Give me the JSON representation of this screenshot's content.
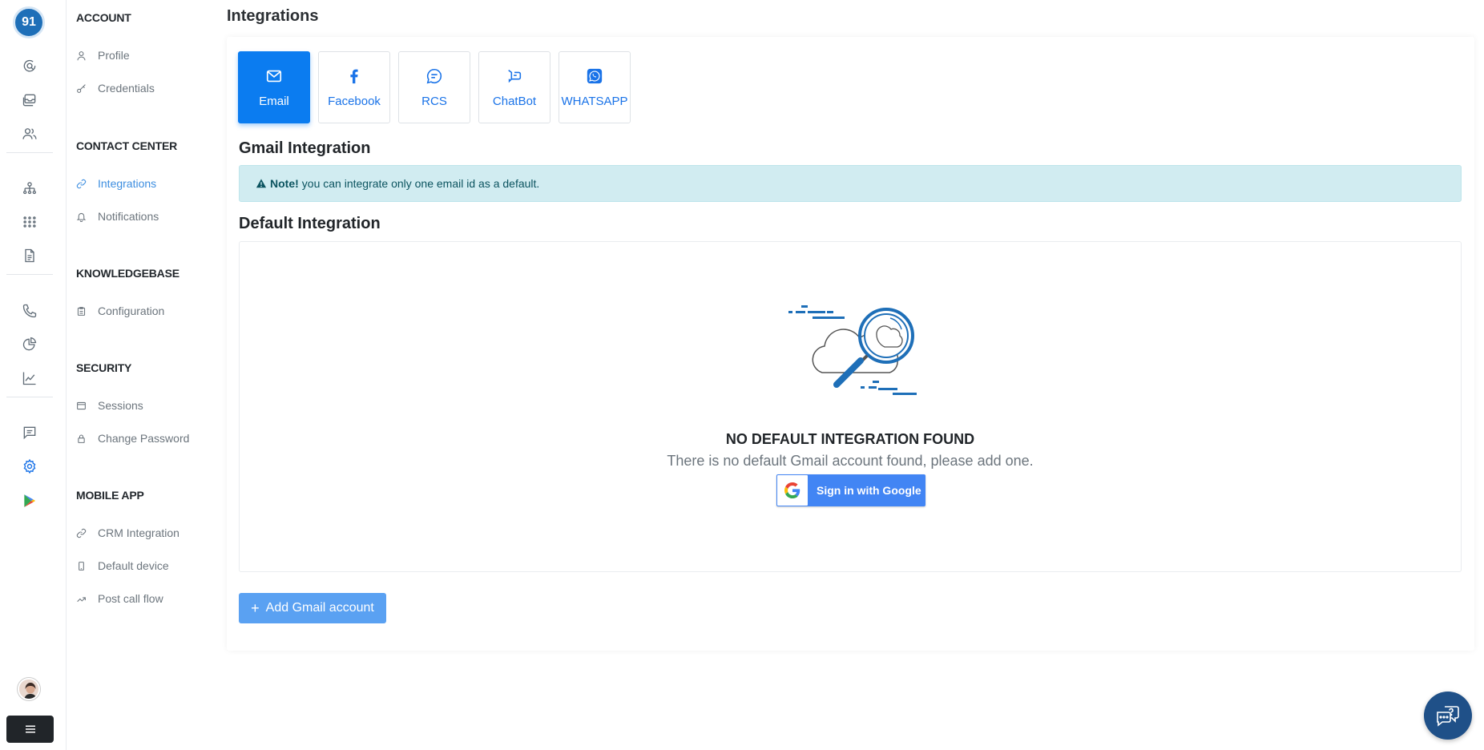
{
  "rail": {
    "logo_text": "91",
    "icons": [
      "chat-search-icon",
      "inbox-icon",
      "users-icon",
      "org-chart-icon",
      "dialpad-icon",
      "document-icon",
      "phone-icon",
      "pie-chart-icon",
      "line-chart-icon",
      "message-icon",
      "gear-icon",
      "play-store-icon"
    ],
    "active_icon": "gear-icon"
  },
  "sidebar": {
    "sections": [
      {
        "title": "ACCOUNT",
        "items": [
          {
            "label": "Profile",
            "icon": "user-icon"
          },
          {
            "label": "Credentials",
            "icon": "key-icon"
          }
        ]
      },
      {
        "title": "CONTACT CENTER",
        "items": [
          {
            "label": "Integrations",
            "icon": "link-icon",
            "active": true
          },
          {
            "label": "Notifications",
            "icon": "bell-icon"
          }
        ]
      },
      {
        "title": "KNOWLEDGEBASE",
        "items": [
          {
            "label": "Configuration",
            "icon": "clipboard-icon"
          }
        ]
      },
      {
        "title": "SECURITY",
        "items": [
          {
            "label": "Sessions",
            "icon": "window-icon"
          },
          {
            "label": "Change Password",
            "icon": "lock-icon"
          }
        ]
      },
      {
        "title": "MOBILE APP",
        "items": [
          {
            "label": "CRM Integration",
            "icon": "link-icon"
          },
          {
            "label": "Default device",
            "icon": "mobile-icon"
          },
          {
            "label": "Post call flow",
            "icon": "trend-icon"
          }
        ]
      }
    ]
  },
  "page": {
    "title": "Integrations"
  },
  "tabs": [
    {
      "label": "Email",
      "icon": "envelope-icon",
      "active": true
    },
    {
      "label": "Facebook",
      "icon": "facebook-icon"
    },
    {
      "label": "RCS",
      "icon": "chat-bubble-icon"
    },
    {
      "label": "ChatBot",
      "icon": "chatbot-icon"
    },
    {
      "label": "WHATSAPP",
      "icon": "whatsapp-icon"
    }
  ],
  "gmail": {
    "heading": "Gmail Integration",
    "note_label": "Note!",
    "note_text": "you can integrate only one email id as a default.",
    "default_heading": "Default Integration",
    "empty_title": "NO DEFAULT INTEGRATION FOUND",
    "empty_subtitle": "There is no default Gmail account found, please add one.",
    "google_button": "Sign in with Google",
    "add_button": "Add Gmail account"
  },
  "colors": {
    "primary": "#0b7cf0",
    "link": "#1a73e8",
    "alert_bg": "#d1ecf1",
    "google_blue": "#4285f4",
    "fab": "#1f5088"
  }
}
